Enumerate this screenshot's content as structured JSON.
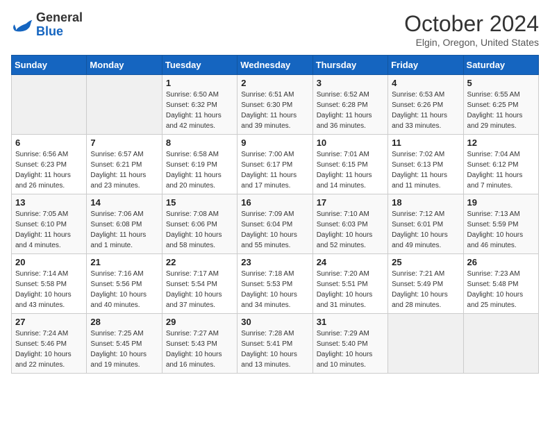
{
  "header": {
    "logo_general": "General",
    "logo_blue": "Blue",
    "month_title": "October 2024",
    "subtitle": "Elgin, Oregon, United States"
  },
  "weekdays": [
    "Sunday",
    "Monday",
    "Tuesday",
    "Wednesday",
    "Thursday",
    "Friday",
    "Saturday"
  ],
  "weeks": [
    [
      {
        "day": "",
        "sunrise": "",
        "sunset": "",
        "daylight": "",
        "empty": true
      },
      {
        "day": "",
        "sunrise": "",
        "sunset": "",
        "daylight": "",
        "empty": true
      },
      {
        "day": "1",
        "sunrise": "Sunrise: 6:50 AM",
        "sunset": "Sunset: 6:32 PM",
        "daylight": "Daylight: 11 hours and 42 minutes."
      },
      {
        "day": "2",
        "sunrise": "Sunrise: 6:51 AM",
        "sunset": "Sunset: 6:30 PM",
        "daylight": "Daylight: 11 hours and 39 minutes."
      },
      {
        "day": "3",
        "sunrise": "Sunrise: 6:52 AM",
        "sunset": "Sunset: 6:28 PM",
        "daylight": "Daylight: 11 hours and 36 minutes."
      },
      {
        "day": "4",
        "sunrise": "Sunrise: 6:53 AM",
        "sunset": "Sunset: 6:26 PM",
        "daylight": "Daylight: 11 hours and 33 minutes."
      },
      {
        "day": "5",
        "sunrise": "Sunrise: 6:55 AM",
        "sunset": "Sunset: 6:25 PM",
        "daylight": "Daylight: 11 hours and 29 minutes."
      }
    ],
    [
      {
        "day": "6",
        "sunrise": "Sunrise: 6:56 AM",
        "sunset": "Sunset: 6:23 PM",
        "daylight": "Daylight: 11 hours and 26 minutes."
      },
      {
        "day": "7",
        "sunrise": "Sunrise: 6:57 AM",
        "sunset": "Sunset: 6:21 PM",
        "daylight": "Daylight: 11 hours and 23 minutes."
      },
      {
        "day": "8",
        "sunrise": "Sunrise: 6:58 AM",
        "sunset": "Sunset: 6:19 PM",
        "daylight": "Daylight: 11 hours and 20 minutes."
      },
      {
        "day": "9",
        "sunrise": "Sunrise: 7:00 AM",
        "sunset": "Sunset: 6:17 PM",
        "daylight": "Daylight: 11 hours and 17 minutes."
      },
      {
        "day": "10",
        "sunrise": "Sunrise: 7:01 AM",
        "sunset": "Sunset: 6:15 PM",
        "daylight": "Daylight: 11 hours and 14 minutes."
      },
      {
        "day": "11",
        "sunrise": "Sunrise: 7:02 AM",
        "sunset": "Sunset: 6:13 PM",
        "daylight": "Daylight: 11 hours and 11 minutes."
      },
      {
        "day": "12",
        "sunrise": "Sunrise: 7:04 AM",
        "sunset": "Sunset: 6:12 PM",
        "daylight": "Daylight: 11 hours and 7 minutes."
      }
    ],
    [
      {
        "day": "13",
        "sunrise": "Sunrise: 7:05 AM",
        "sunset": "Sunset: 6:10 PM",
        "daylight": "Daylight: 11 hours and 4 minutes."
      },
      {
        "day": "14",
        "sunrise": "Sunrise: 7:06 AM",
        "sunset": "Sunset: 6:08 PM",
        "daylight": "Daylight: 11 hours and 1 minute."
      },
      {
        "day": "15",
        "sunrise": "Sunrise: 7:08 AM",
        "sunset": "Sunset: 6:06 PM",
        "daylight": "Daylight: 10 hours and 58 minutes."
      },
      {
        "day": "16",
        "sunrise": "Sunrise: 7:09 AM",
        "sunset": "Sunset: 6:04 PM",
        "daylight": "Daylight: 10 hours and 55 minutes."
      },
      {
        "day": "17",
        "sunrise": "Sunrise: 7:10 AM",
        "sunset": "Sunset: 6:03 PM",
        "daylight": "Daylight: 10 hours and 52 minutes."
      },
      {
        "day": "18",
        "sunrise": "Sunrise: 7:12 AM",
        "sunset": "Sunset: 6:01 PM",
        "daylight": "Daylight: 10 hours and 49 minutes."
      },
      {
        "day": "19",
        "sunrise": "Sunrise: 7:13 AM",
        "sunset": "Sunset: 5:59 PM",
        "daylight": "Daylight: 10 hours and 46 minutes."
      }
    ],
    [
      {
        "day": "20",
        "sunrise": "Sunrise: 7:14 AM",
        "sunset": "Sunset: 5:58 PM",
        "daylight": "Daylight: 10 hours and 43 minutes."
      },
      {
        "day": "21",
        "sunrise": "Sunrise: 7:16 AM",
        "sunset": "Sunset: 5:56 PM",
        "daylight": "Daylight: 10 hours and 40 minutes."
      },
      {
        "day": "22",
        "sunrise": "Sunrise: 7:17 AM",
        "sunset": "Sunset: 5:54 PM",
        "daylight": "Daylight: 10 hours and 37 minutes."
      },
      {
        "day": "23",
        "sunrise": "Sunrise: 7:18 AM",
        "sunset": "Sunset: 5:53 PM",
        "daylight": "Daylight: 10 hours and 34 minutes."
      },
      {
        "day": "24",
        "sunrise": "Sunrise: 7:20 AM",
        "sunset": "Sunset: 5:51 PM",
        "daylight": "Daylight: 10 hours and 31 minutes."
      },
      {
        "day": "25",
        "sunrise": "Sunrise: 7:21 AM",
        "sunset": "Sunset: 5:49 PM",
        "daylight": "Daylight: 10 hours and 28 minutes."
      },
      {
        "day": "26",
        "sunrise": "Sunrise: 7:23 AM",
        "sunset": "Sunset: 5:48 PM",
        "daylight": "Daylight: 10 hours and 25 minutes."
      }
    ],
    [
      {
        "day": "27",
        "sunrise": "Sunrise: 7:24 AM",
        "sunset": "Sunset: 5:46 PM",
        "daylight": "Daylight: 10 hours and 22 minutes."
      },
      {
        "day": "28",
        "sunrise": "Sunrise: 7:25 AM",
        "sunset": "Sunset: 5:45 PM",
        "daylight": "Daylight: 10 hours and 19 minutes."
      },
      {
        "day": "29",
        "sunrise": "Sunrise: 7:27 AM",
        "sunset": "Sunset: 5:43 PM",
        "daylight": "Daylight: 10 hours and 16 minutes."
      },
      {
        "day": "30",
        "sunrise": "Sunrise: 7:28 AM",
        "sunset": "Sunset: 5:41 PM",
        "daylight": "Daylight: 10 hours and 13 minutes."
      },
      {
        "day": "31",
        "sunrise": "Sunrise: 7:29 AM",
        "sunset": "Sunset: 5:40 PM",
        "daylight": "Daylight: 10 hours and 10 minutes."
      },
      {
        "day": "",
        "sunrise": "",
        "sunset": "",
        "daylight": "",
        "empty": true
      },
      {
        "day": "",
        "sunrise": "",
        "sunset": "",
        "daylight": "",
        "empty": true
      }
    ]
  ]
}
